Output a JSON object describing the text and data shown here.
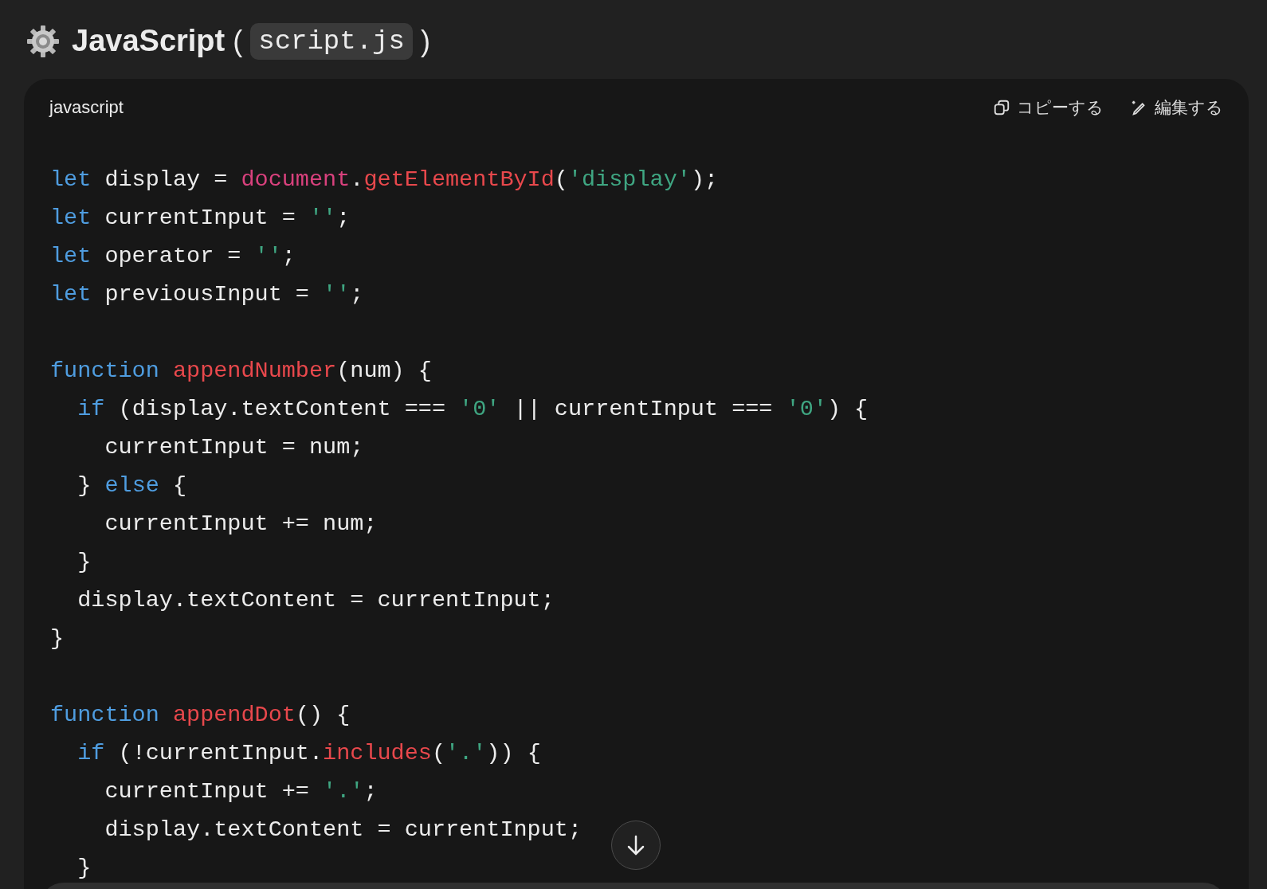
{
  "heading": {
    "title": "JavaScript",
    "open_paren": "(",
    "filename": "script.js",
    "close_paren": ")"
  },
  "code_block": {
    "language": "javascript",
    "actions": [
      {
        "kind": "copy",
        "label": "コピーする"
      },
      {
        "kind": "edit",
        "label": "編集する"
      }
    ],
    "blocks": [
      [
        [
          {
            "kind": "keyword",
            "text": "let"
          },
          {
            "kind": "plain",
            "text": " display = "
          },
          {
            "kind": "builtin",
            "text": "document"
          },
          {
            "kind": "plain",
            "text": "."
          },
          {
            "kind": "function",
            "text": "getElementById"
          },
          {
            "kind": "plain",
            "text": "("
          },
          {
            "kind": "string",
            "text": "'display'"
          },
          {
            "kind": "plain",
            "text": ");"
          }
        ],
        [
          {
            "kind": "keyword",
            "text": "let"
          },
          {
            "kind": "plain",
            "text": " currentInput = "
          },
          {
            "kind": "string",
            "text": "''"
          },
          {
            "kind": "plain",
            "text": ";"
          }
        ],
        [
          {
            "kind": "keyword",
            "text": "let"
          },
          {
            "kind": "plain",
            "text": " operator = "
          },
          {
            "kind": "string",
            "text": "''"
          },
          {
            "kind": "plain",
            "text": ";"
          }
        ],
        [
          {
            "kind": "keyword",
            "text": "let"
          },
          {
            "kind": "plain",
            "text": " previousInput = "
          },
          {
            "kind": "string",
            "text": "''"
          },
          {
            "kind": "plain",
            "text": ";"
          }
        ]
      ],
      [
        [
          {
            "kind": "keyword",
            "text": "function "
          },
          {
            "kind": "function",
            "text": "appendNumber"
          },
          {
            "kind": "plain",
            "text": "(num) {"
          }
        ],
        [
          {
            "kind": "keyword",
            "text": "  if"
          },
          {
            "kind": "plain",
            "text": " (display.textContent === "
          },
          {
            "kind": "string",
            "text": "'0'"
          },
          {
            "kind": "plain",
            "text": " || currentInput === "
          },
          {
            "kind": "string",
            "text": "'0'"
          },
          {
            "kind": "plain",
            "text": ") {"
          }
        ],
        [
          {
            "kind": "plain",
            "text": "    currentInput = num;"
          }
        ],
        [
          {
            "kind": "plain",
            "text": "  } "
          },
          {
            "kind": "keyword",
            "text": "else"
          },
          {
            "kind": "plain",
            "text": " {"
          }
        ],
        [
          {
            "kind": "plain",
            "text": "    currentInput += num;"
          }
        ],
        [
          {
            "kind": "plain",
            "text": "  }"
          }
        ],
        [
          {
            "kind": "plain",
            "text": "  display.textContent = currentInput;"
          }
        ],
        [
          {
            "kind": "plain",
            "text": "}"
          }
        ]
      ],
      [
        [
          {
            "kind": "keyword",
            "text": "function "
          },
          {
            "kind": "function",
            "text": "appendDot"
          },
          {
            "kind": "plain",
            "text": "() {"
          }
        ],
        [
          {
            "kind": "keyword",
            "text": "  if"
          },
          {
            "kind": "plain",
            "text": " (!currentInput."
          },
          {
            "kind": "function",
            "text": "includes"
          },
          {
            "kind": "plain",
            "text": "("
          },
          {
            "kind": "string",
            "text": "'.'"
          },
          {
            "kind": "plain",
            "text": ")) {"
          }
        ],
        [
          {
            "kind": "plain",
            "text": "    currentInput += "
          },
          {
            "kind": "string",
            "text": "'.'"
          },
          {
            "kind": "plain",
            "text": ";"
          }
        ],
        [
          {
            "kind": "plain",
            "text": "    display.textContent = currentInput;"
          }
        ],
        [
          {
            "kind": "plain",
            "text": "  }"
          }
        ]
      ]
    ]
  }
}
